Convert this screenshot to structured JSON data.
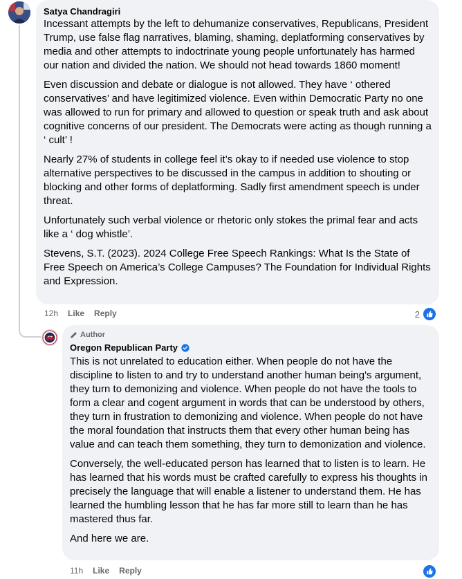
{
  "comment1": {
    "author": "Satya Chandragiri",
    "paragraphs": [
      "Incessant attempts by the left to dehumanize conservatives, Republicans, President Trump, use false flag narratives, blaming, shaming, deplatforming conservatives by media and other attempts to indoctrinate young people unfortunately has harmed our nation and divided the nation. We should not head towards 1860 moment!",
      "Even discussion and debate or dialogue is not allowed. They have ‘ othered conservatives’ and have legitimized violence. Even within Democratic Party no one was allowed to run for primary and allowed to question or speak truth and ask about cognitive concerns of our president. The Democrats were acting as though running a ‘ cult’ !",
      "Nearly 27% of students in college feel it’s okay to if needed use violence to stop alternative perspectives to be discussed in the campus in addition to shouting or blocking and other forms of deplatforming. Sadly first amendment speech is under threat.",
      "Unfortunately such verbal violence or rhetoric only stokes the primal fear and acts like a ‘ dog whistle’.",
      "Stevens, S.T. (2023). 2024 College Free Speech Rankings: What Is the State of Free Speech on America’s College Campuses? The Foundation for Individual Rights and Expression."
    ],
    "time": "12h",
    "like_label": "Like",
    "reply_label": "Reply",
    "reaction_count": "2"
  },
  "comment2": {
    "badge": "Author",
    "author": "Oregon Republican Party",
    "paragraphs": [
      "This is not unrelated to education either. When people do not have the discipline to listen to and try to understand another human being's argument, they turn to demonizing and violence. When people do not have the tools to form a clear and cogent argument in words that can be understood by others, they turn in frustration to demonizing and violence. When people do not have the moral foundation that instructs them that every other human being has value and can teach them something, they turn to demonization and violence.",
      "Conversely, the well-educated person has learned that to listen is to learn. He has learned that his words must be crafted carefully to express his thoughts in precisely the language that will enable a listener to understand them. He has learned the humbling lesson that he has far more still to learn than he has mastered thus far.",
      "And here we are."
    ],
    "time": "11h",
    "like_label": "Like",
    "reply_label": "Reply"
  },
  "colors": {
    "bubble": "#f0f2f5",
    "like_blue": "#1b74e4",
    "muted": "#65676b"
  },
  "icons": [
    "avatar-photo",
    "gop-logo-avatar",
    "pencil-icon",
    "verified-badge-icon",
    "like-thumb-icon"
  ]
}
